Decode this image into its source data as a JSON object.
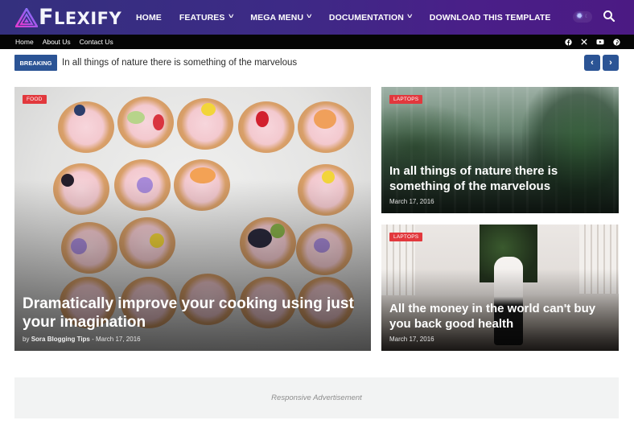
{
  "brand": {
    "name": "Flexify",
    "logo_icon": "triangle-logo-icon"
  },
  "nav": {
    "items": [
      {
        "label": "HOME",
        "has_dropdown": false
      },
      {
        "label": "FEATURES",
        "has_dropdown": true
      },
      {
        "label": "MEGA MENU",
        "has_dropdown": true
      },
      {
        "label": "DOCUMENTATION",
        "has_dropdown": true
      },
      {
        "label": "DOWNLOAD THIS TEMPLATE",
        "has_dropdown": false
      }
    ],
    "dropdown_glyph": "˅",
    "theme_toggle": {
      "sun_icon": "✹",
      "moon_icon": "☾"
    },
    "search_icon": "search-icon"
  },
  "topbar": {
    "links": [
      "Home",
      "About Us",
      "Contact Us"
    ],
    "socials": [
      "facebook",
      "x",
      "youtube",
      "pinterest"
    ]
  },
  "breaking": {
    "label": "BREAKING",
    "text": "In all things of nature there is something of the marvelous",
    "prev_glyph": "‹",
    "next_glyph": "›"
  },
  "posts": {
    "main": {
      "category": "FOOD",
      "title": "Dramatically improve your cooking using just your imagination",
      "by": "by",
      "author": "Sora Blogging Tips",
      "separator": "-",
      "date": "March 17, 2016"
    },
    "side": [
      {
        "category": "LAPTOPS",
        "title": "In all things of nature there is something of the marvelous",
        "date": "March 17, 2016"
      },
      {
        "category": "LAPTOPS",
        "title": "All the money in the world can't buy you back good health",
        "date": "March 17, 2016"
      }
    ]
  },
  "ad": {
    "text": "Responsive Advertisement"
  },
  "colors": {
    "header_start": "#34307e",
    "header_end": "#4b1a83",
    "topbar": "#050505",
    "accent_blue": "#2b5495",
    "badge_red": "#e2383d",
    "ad_bg": "#f2f3f3"
  }
}
